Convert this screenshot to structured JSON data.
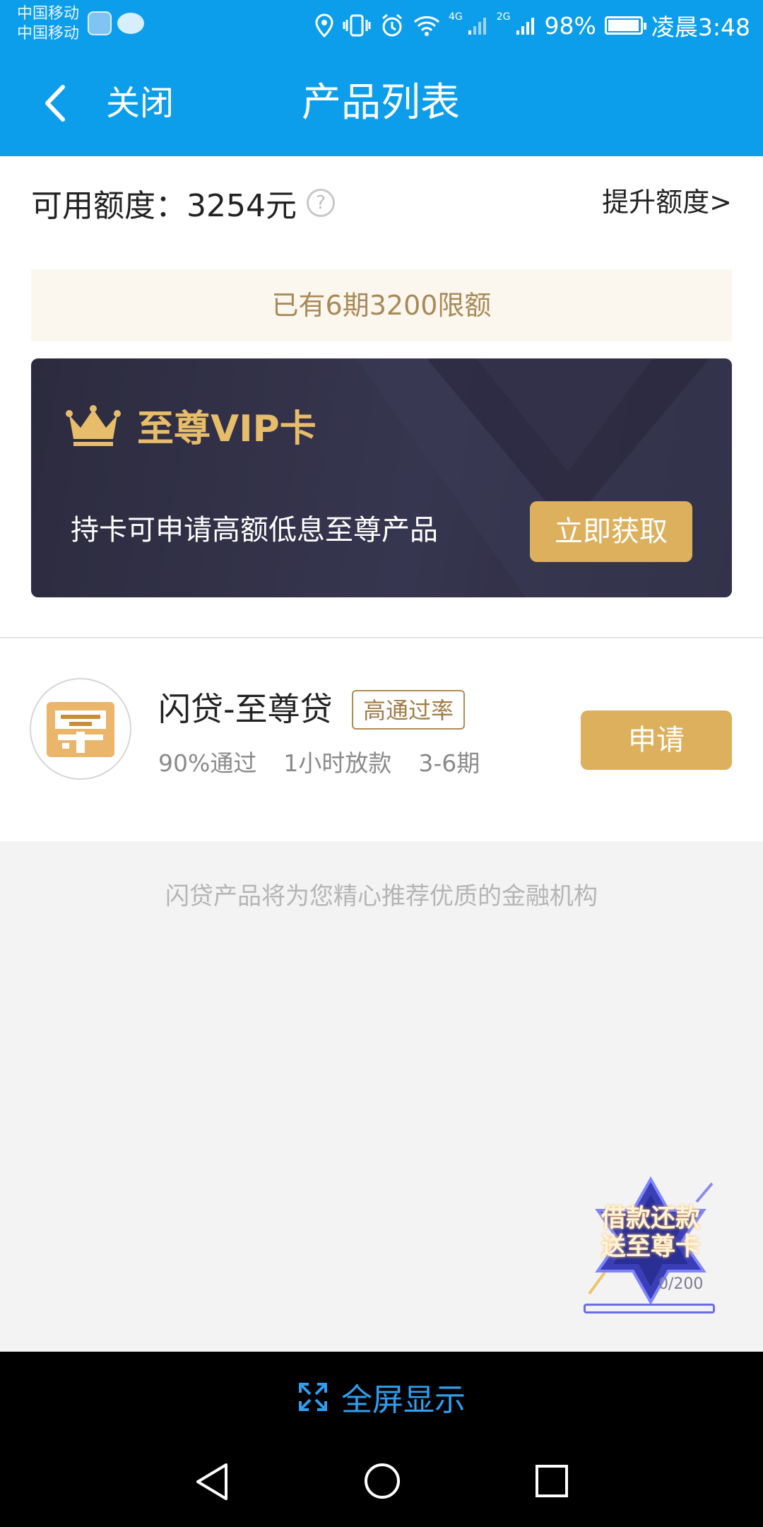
{
  "status_bar": {
    "carrier_line1": "中国移动",
    "carrier_line2": "中国移动",
    "net_4g": "4G",
    "net_2g": "2G",
    "battery": "98%",
    "time": "凌晨3:48"
  },
  "header": {
    "back_icon": "chevron-left-icon",
    "close_label": "关闭",
    "title": "产品列表"
  },
  "quota": {
    "label": "可用额度：3254元",
    "help_glyph": "?",
    "raise_link": "提升额度>"
  },
  "notice": "已有6期3200限额",
  "vip_card": {
    "title": "至尊VIP卡",
    "description": "持卡可申请高额低息至尊产品",
    "button": "立即获取",
    "icon": "crown-icon"
  },
  "products": [
    {
      "name": "闪贷-至尊贷",
      "tag": "高通过率",
      "pass_rate": "90%通过",
      "loan_time": "1小时放款",
      "terms": "3-6期",
      "button": "申请"
    }
  ],
  "footer_hint": "闪贷产品将为您精心推荐优质的金融机构",
  "promo_badge": {
    "line1": "借款还款",
    "line2": "送至尊卡",
    "count": "0/200"
  },
  "fullscreen": {
    "label": "全屏显示",
    "icon": "expand-icon"
  },
  "colors": {
    "primary_blue": "#0d9eeb",
    "gold": "#dcb05d",
    "vip_dark": "#2c2b3e"
  }
}
